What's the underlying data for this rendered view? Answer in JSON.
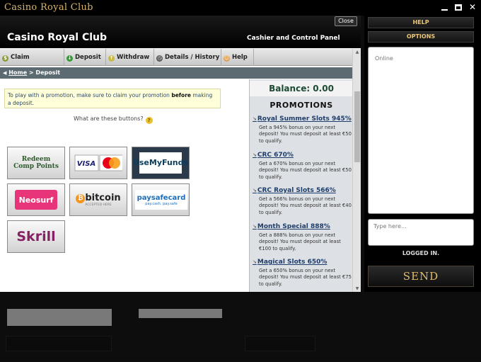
{
  "window": {
    "title": "Casino Royal Club",
    "controls": [
      "minimize-icon",
      "maximize-icon",
      "close-icon"
    ]
  },
  "dialog": {
    "close_label": "Close",
    "brand": "Casino Royal Club",
    "panel_title": "Cashier and Control Panel",
    "nav": [
      {
        "label": "Claim Promotion",
        "icon": "coin-icon"
      },
      {
        "label": "Deposit",
        "icon": "down-arrow-icon"
      },
      {
        "label": "Withdraw",
        "icon": "up-arrow-icon"
      },
      {
        "label": "Details / History",
        "icon": "clock-icon"
      },
      {
        "label": "Help",
        "icon": "help-icon"
      }
    ],
    "breadcrumb": {
      "home": "Home",
      "separator": " > ",
      "current": "Deposit"
    },
    "notice": {
      "text_before": "To play with a promotion, make sure to claim your promotion ",
      "bold": "before",
      "text_after": " making a deposit."
    },
    "what_buttons": "What are these buttons?",
    "payment_methods": [
      "Redeem Comp Points",
      "VISA MasterCard",
      "UseMyFunds",
      "Neosurf",
      "bitcoin",
      "paysafecard",
      "Skrill"
    ],
    "bitcoin_sub": "ACCEPTED HERE",
    "paysafe_sub": "pay.cash. pay.safe",
    "balance": "Balance: 0.00",
    "promotions_heading": "PROMOTIONS",
    "promotions": [
      {
        "title": "Royal Summer Slots 945%",
        "desc": "Get a 945% bonus on your next deposit! You must deposit at least €50 to qualify."
      },
      {
        "title": "CRC 670%",
        "desc": "Get a 670% bonus on your next deposit! You must deposit at least €50 to qualify."
      },
      {
        "title": "CRC Royal Slots 566%",
        "desc": "Get a 566% bonus on your next deposit! You must deposit at least €40 to qualify."
      },
      {
        "title": "Month Special 888%",
        "desc": "Get a 888% bonus on your next deposit! You must deposit at least €100 to qualify."
      },
      {
        "title": "Magical Slots 650%",
        "desc": "Get a 650% bonus on your next deposit! You must deposit at least €75 to qualify."
      }
    ]
  },
  "chat": {
    "help": "HELP",
    "options": "OPTIONS",
    "online": "Online",
    "placeholder": "Type here...",
    "status": "LOGGED IN.",
    "send": "SEND"
  },
  "colors": {
    "gold": "#e2bb6c",
    "balance_green": "#1d4a33",
    "breadcrumb_bg": "#5c6b72",
    "notice_bg": "#ffffd9",
    "promo_link": "#1e3d6b"
  }
}
